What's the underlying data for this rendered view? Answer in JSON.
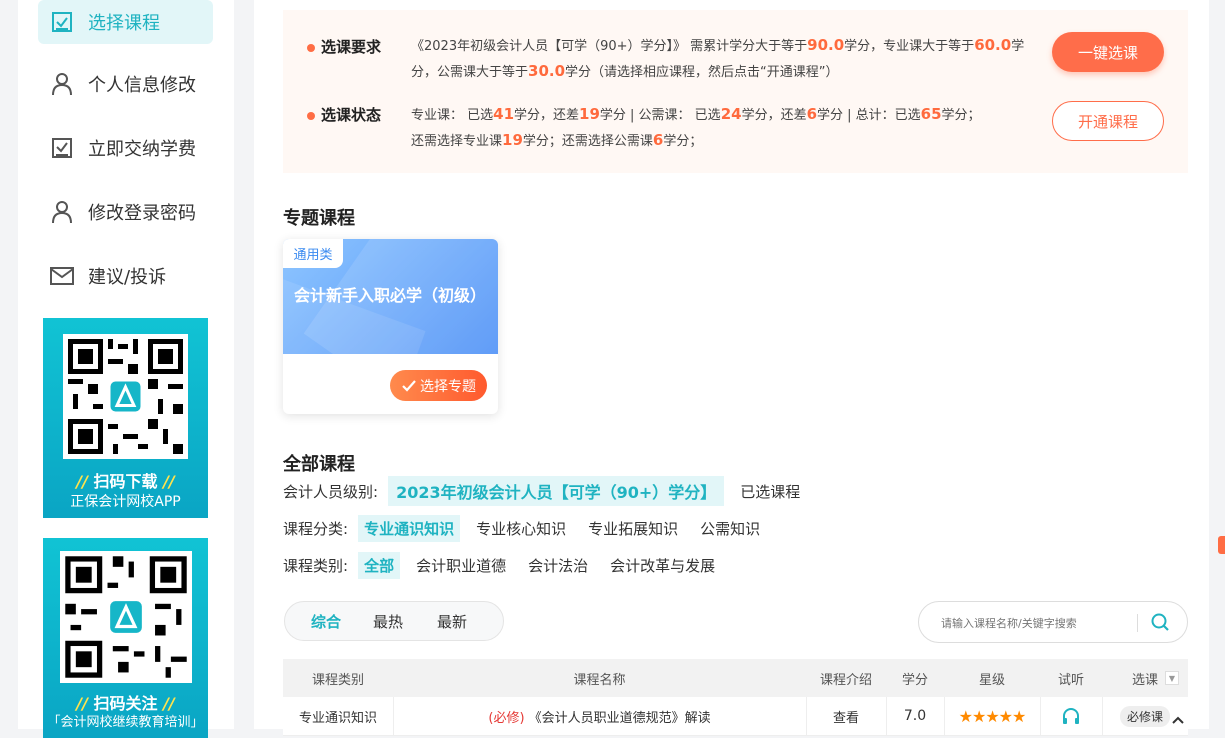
{
  "sidebar": {
    "items": [
      {
        "label": "选择课程",
        "icon": "checkbox-icon",
        "active": true
      },
      {
        "label": "个人信息修改",
        "icon": "user-icon",
        "active": false
      },
      {
        "label": "立即交纳学费",
        "icon": "checkbox-icon",
        "active": false
      },
      {
        "label": "修改登录密码",
        "icon": "user-icon",
        "active": false
      },
      {
        "label": "建议/投诉",
        "icon": "mail-icon",
        "active": false
      }
    ],
    "qr1": {
      "title": "扫码下载",
      "slash": "//",
      "subtitle": "正保会计网校APP"
    },
    "qr2": {
      "title": "扫码关注",
      "slash": "//",
      "subtitle": "「会计网校继续教育培训」"
    }
  },
  "requirement": {
    "label1": "选课要求",
    "text1_a": "《2023年初级会计人员【可学（90+）学分】》 需累计学分大于等于",
    "total_min": "90.0",
    "text1_b": "学分，专业课大于等于",
    "pro_min": "60.0",
    "text1_c": "学分，公需课大于等于",
    "pub_min": "30.0",
    "text1_d": "学分（请选择相应课程，然后点击“开通课程”）",
    "label2": "选课状态",
    "s_a": "专业课：  已选",
    "pro_selected": "41",
    "s_b": "学分，还差",
    "pro_remaining": "19",
    "s_c": "学分 | 公需课：  已选",
    "pub_selected": "24",
    "s_d": "学分，还差",
    "pub_remaining": "6",
    "s_e": "学分 | 总计：已选",
    "total_selected": "65",
    "s_f": "学分；",
    "s_g": "还需选择专业课",
    "need_pro": "19",
    "s_h": "学分；还需选择公需课",
    "need_pub": "6",
    "s_i": "学分；",
    "btn_one_click": "一键选课",
    "btn_open": "开通课程"
  },
  "topics": {
    "title": "专题课程",
    "card": {
      "tag": "通用类",
      "title": "会计新手入职必学（初级）",
      "button": "选择专题"
    }
  },
  "all_courses": {
    "title": "全部课程",
    "level_label": "会计人员级别:",
    "level_value": "2023年初级会计人员【可学（90+）学分】",
    "selected_link": "已选课程",
    "category_label": "课程分类:",
    "categories": [
      "专业通识知识",
      "专业核心知识",
      "专业拓展知识",
      "公需知识"
    ],
    "type_label": "课程类别:",
    "types": [
      "全部",
      "会计职业道德",
      "会计法治",
      "会计改革与发展"
    ]
  },
  "sort": {
    "options": [
      "综合",
      "最热",
      "最新"
    ],
    "active": 0
  },
  "search": {
    "placeholder": "请输入课程名称/关键字搜索"
  },
  "table": {
    "headers": [
      "课程类别",
      "课程名称",
      "课程介绍",
      "学分",
      "星级",
      "试听",
      "选课"
    ],
    "rows": [
      {
        "category": "专业通识知识",
        "tag": "(必修)",
        "name": "《会计人员职业道德规范》解读",
        "intro": "查看",
        "credit": "7.0",
        "stars": "★★★★★",
        "rating": 5,
        "select": "必修课"
      }
    ]
  },
  "colors": {
    "accent": "#1fb3c1",
    "orange": "#ff6d4a"
  }
}
